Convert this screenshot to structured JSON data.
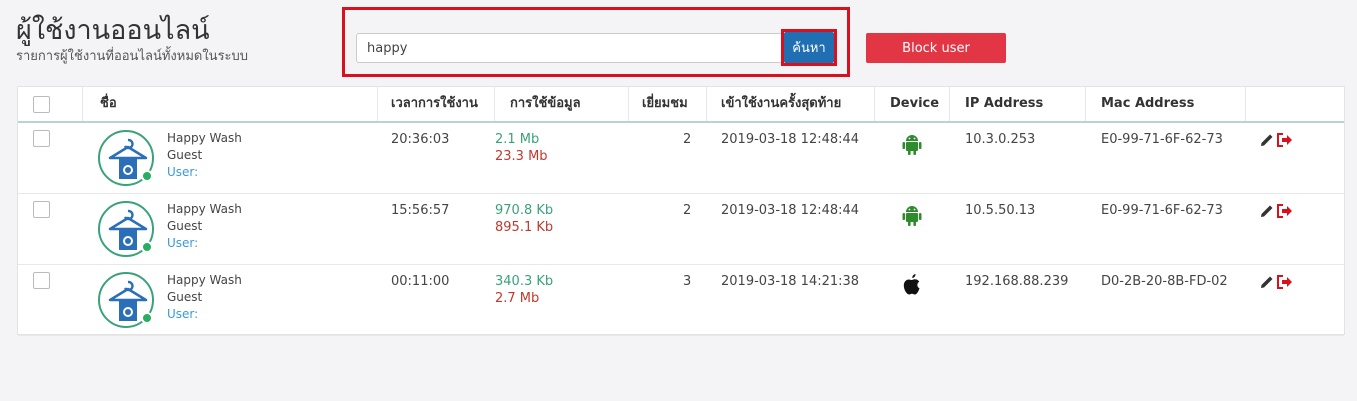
{
  "header": {
    "title": "ผู้ใช้งานออนไลน์",
    "subtitle": "รายการผู้ใช้งานที่ออนไลน์ทั้งหมดในระบบ"
  },
  "search": {
    "value": "happy",
    "button_label": "ค้นหา"
  },
  "block_button_label": "Block user",
  "table": {
    "columns": [
      "ชื่อ",
      "เวลาการใช้งาน",
      "การใช้ข้อมูล",
      "เยี่ยมชม",
      "เข้าใช้งานครั้งสุดท้าย",
      "Device",
      "IP Address",
      "Mac Address"
    ],
    "rows": [
      {
        "name": "Happy Wash",
        "type": "Guest",
        "user": "User:",
        "time": "20:36:03",
        "download": "2.1 Mb",
        "upload": "23.3 Mb",
        "visits": "2",
        "last_login": "2019-03-18 12:48:44",
        "device": "android-icon",
        "ip": "10.3.0.253",
        "mac": "E0-99-71-6F-62-73"
      },
      {
        "name": "Happy Wash",
        "type": "Guest",
        "user": "User:",
        "time": "15:56:57",
        "download": "970.8 Kb",
        "upload": "895.1 Kb",
        "visits": "2",
        "last_login": "2019-03-18 12:48:44",
        "device": "android-icon",
        "ip": "10.5.50.13",
        "mac": "E0-99-71-6F-62-73"
      },
      {
        "name": "Happy Wash",
        "type": "Guest",
        "user": "User:",
        "time": "00:11:00",
        "download": "340.3 Kb",
        "upload": "2.7 Mb",
        "visits": "3",
        "last_login": "2019-03-18 14:21:38",
        "device": "apple-icon",
        "ip": "192.168.88.239",
        "mac": "D0-2B-20-8B-FD-02"
      }
    ]
  },
  "colors": {
    "search_button": "#1f6fb2",
    "block_button": "#e33645",
    "highlight": "#d9101d",
    "online": "#27ae60",
    "android": "#2e8b2e"
  }
}
